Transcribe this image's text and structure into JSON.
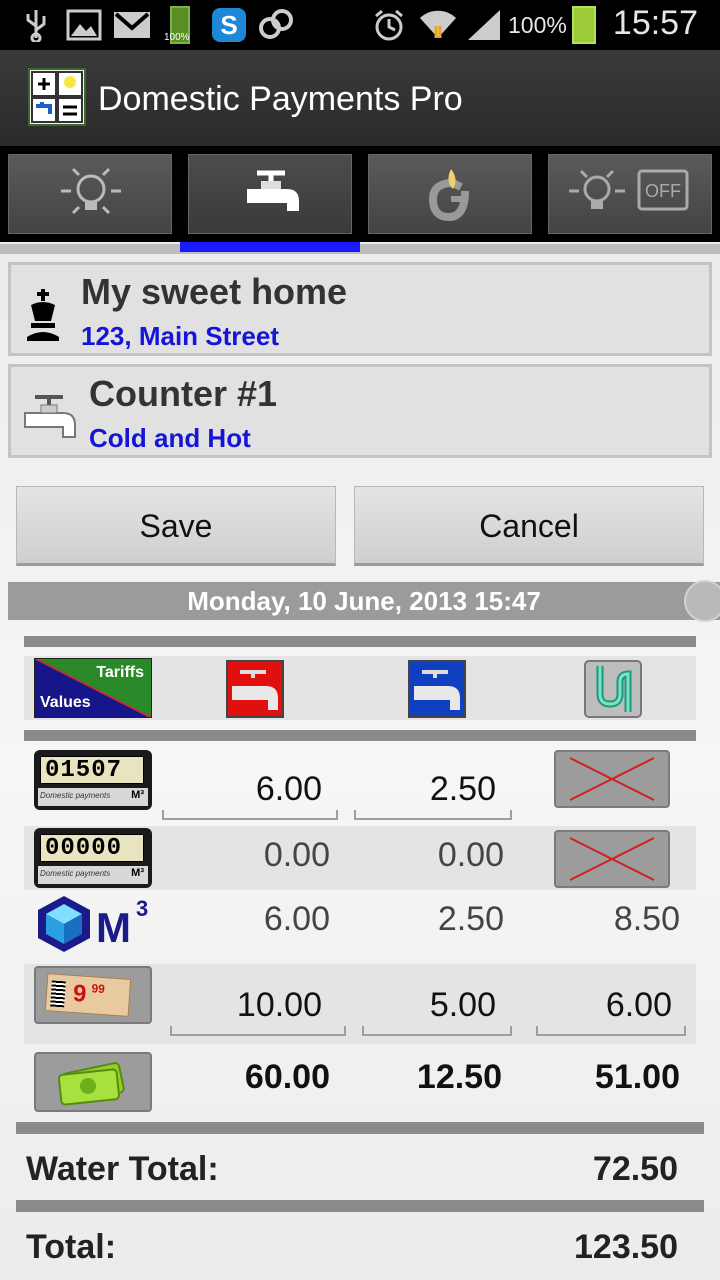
{
  "status_bar": {
    "battery_small": "100%",
    "battery_percent": "100%",
    "time": "15:57"
  },
  "app": {
    "title": "Domestic Payments Pro"
  },
  "tabs": [
    {
      "name": "electricity",
      "icon": "lightbulb-icon",
      "active": false
    },
    {
      "name": "water",
      "icon": "water-tap-icon",
      "active": true
    },
    {
      "name": "gas",
      "icon": "gas-flame-icon",
      "active": false
    },
    {
      "name": "electricity-off",
      "icon": "lightbulb-off-icon",
      "active": false
    }
  ],
  "home": {
    "title": "My sweet home",
    "address": "123, Main Street"
  },
  "counter": {
    "title": "Counter #1",
    "type": "Cold and Hot"
  },
  "buttons": {
    "save": "Save",
    "cancel": "Cancel"
  },
  "date": "Monday, 10 June, 2013 15:47",
  "table": {
    "header": {
      "tariffs_label": "Tariffs",
      "values_label": "Values"
    },
    "meter_current_digits": "01507",
    "meter_previous_digits": "00000",
    "meter_brand": "Domestic payments",
    "meter_unit": "M³",
    "m3_label": "M",
    "m3_superscript": "3",
    "price_tag": "9",
    "price_tag_cents": "99",
    "rows": {
      "current": [
        "6.00",
        "2.50"
      ],
      "previous": [
        "0.00",
        "0.00"
      ],
      "usage": [
        "6.00",
        "2.50",
        "8.50"
      ],
      "tariff": [
        "10.00",
        "5.00",
        "6.00"
      ],
      "cost": [
        "60.00",
        "12.50",
        "51.00"
      ]
    }
  },
  "totals": {
    "water_label": "Water Total:",
    "water_value": "72.50",
    "total_label": "Total:",
    "total_value": "123.50"
  },
  "colors": {
    "accent_blue": "#1515d8",
    "tab_indicator": "#1a1aff",
    "hot_water": "#e01010",
    "cold_water": "#1040c0"
  }
}
